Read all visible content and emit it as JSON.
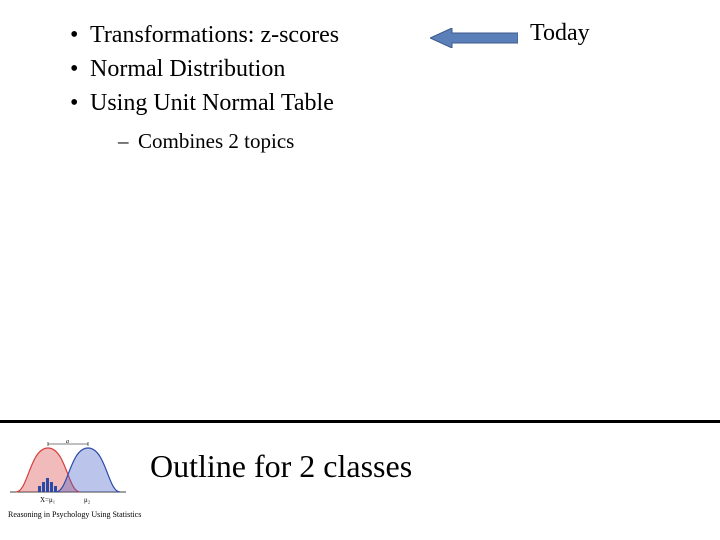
{
  "bullets": {
    "b1": "Transformations: z-scores",
    "b2": "Normal Distribution",
    "b3": "Using Unit Normal Table",
    "sub1": "Combines 2 topics"
  },
  "today": "Today",
  "footer_title": "Outline for 2 classes",
  "footer_caption": "Reasoning in Psychology Using Statistics",
  "axis_labels": {
    "left": "X=μ₁",
    "right": "μ₂"
  },
  "arrow_color": "#5b7fb8",
  "arrow_color_dark": "#3d5a8c"
}
